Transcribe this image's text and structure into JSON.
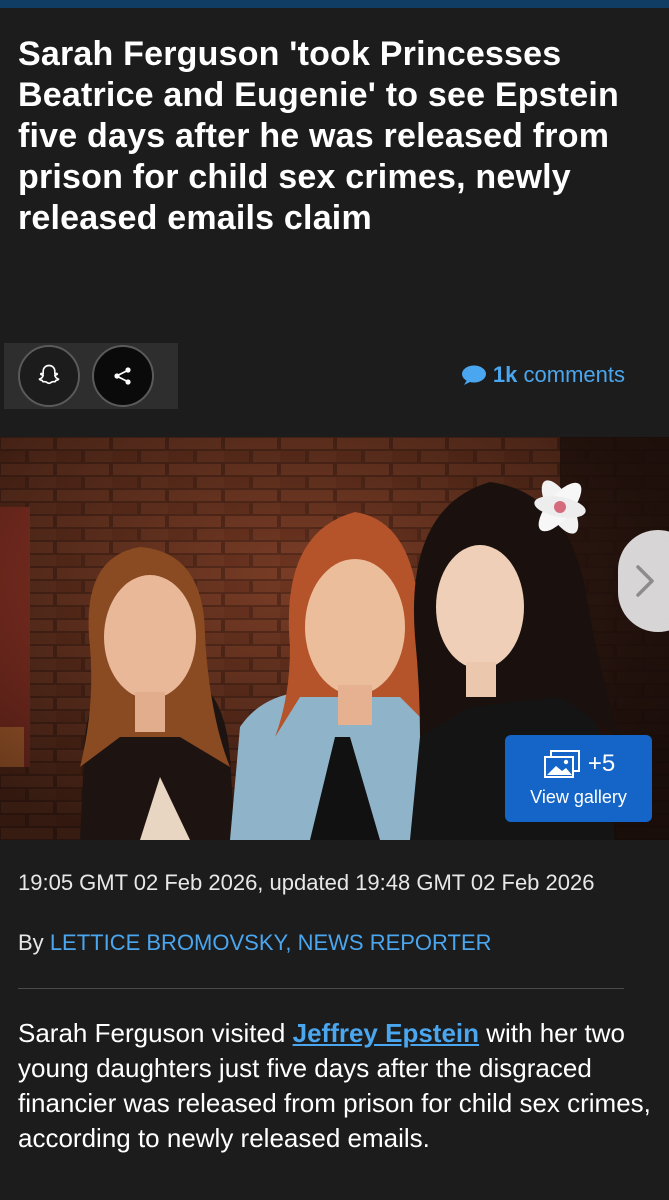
{
  "article": {
    "headline": "Sarah Ferguson 'took Princesses Beatrice and Eugenie' to see Epstein five days after he was released from prison for child sex crimes, newly released emails claim",
    "comments": {
      "count": "1k",
      "label": "comments"
    },
    "gallery": {
      "extra_count": "+5",
      "label": "View gallery"
    },
    "dateline": "19:05 GMT 02 Feb 2026, updated 19:48 GMT 02 Feb 2026",
    "byline": {
      "prefix": "By",
      "author": "LETTICE BROMOVSKY, NEWS REPORTER"
    },
    "body": {
      "lead": "Sarah Ferguson visited",
      "link": "Jeffrey Epstein",
      "rest": "with her two young daughters just five days after the disgraced financier was released from prison for child sex crimes, according to newly released emails."
    }
  },
  "icons": {
    "share_snapchat": "snapchat-icon",
    "share_generic": "share-icon",
    "comment": "speech-bubble-icon",
    "gallery": "image-stack-icon",
    "next": "chevron-right-icon"
  },
  "colors": {
    "accent": "#4aa6ee",
    "gallery_button": "#1565c8",
    "background": "#1c1c1c"
  }
}
